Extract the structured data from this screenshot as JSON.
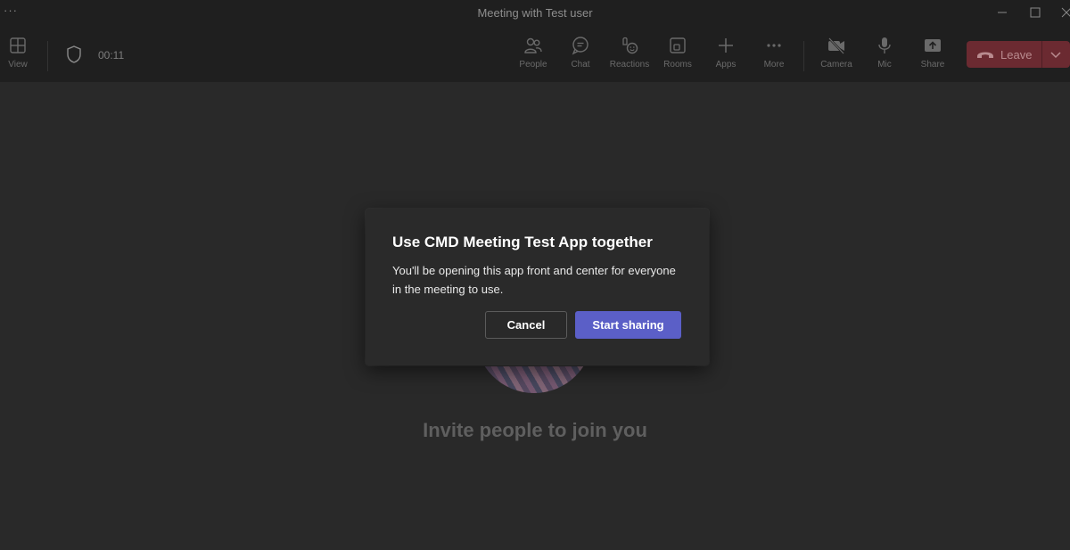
{
  "titlebar": {
    "more_dots": "···",
    "title": "Meeting with Test user"
  },
  "toolbar": {
    "view_label": "View",
    "timer": "00:11",
    "items": [
      {
        "label": "People",
        "icon": "people-icon"
      },
      {
        "label": "Chat",
        "icon": "chat-icon"
      },
      {
        "label": "Reactions",
        "icon": "reactions-icon"
      },
      {
        "label": "Rooms",
        "icon": "rooms-icon"
      },
      {
        "label": "Apps",
        "icon": "plus-icon"
      },
      {
        "label": "More",
        "icon": "more-icon"
      },
      {
        "label": "Camera",
        "icon": "camera-off-icon"
      },
      {
        "label": "Mic",
        "icon": "mic-icon"
      },
      {
        "label": "Share",
        "icon": "share-icon"
      }
    ],
    "leave_label": "Leave"
  },
  "stage": {
    "invite_text": "Invite people to join you"
  },
  "dialog": {
    "title": "Use CMD Meeting Test App together",
    "body": "You'll be opening this app front and center for everyone in the meeting to use.",
    "cancel_label": "Cancel",
    "confirm_label": "Start sharing"
  },
  "colors": {
    "background": "#292929",
    "toolbar": "#1f1f1f",
    "primary": "#5b5fc7",
    "leave": "#6b2a31"
  }
}
